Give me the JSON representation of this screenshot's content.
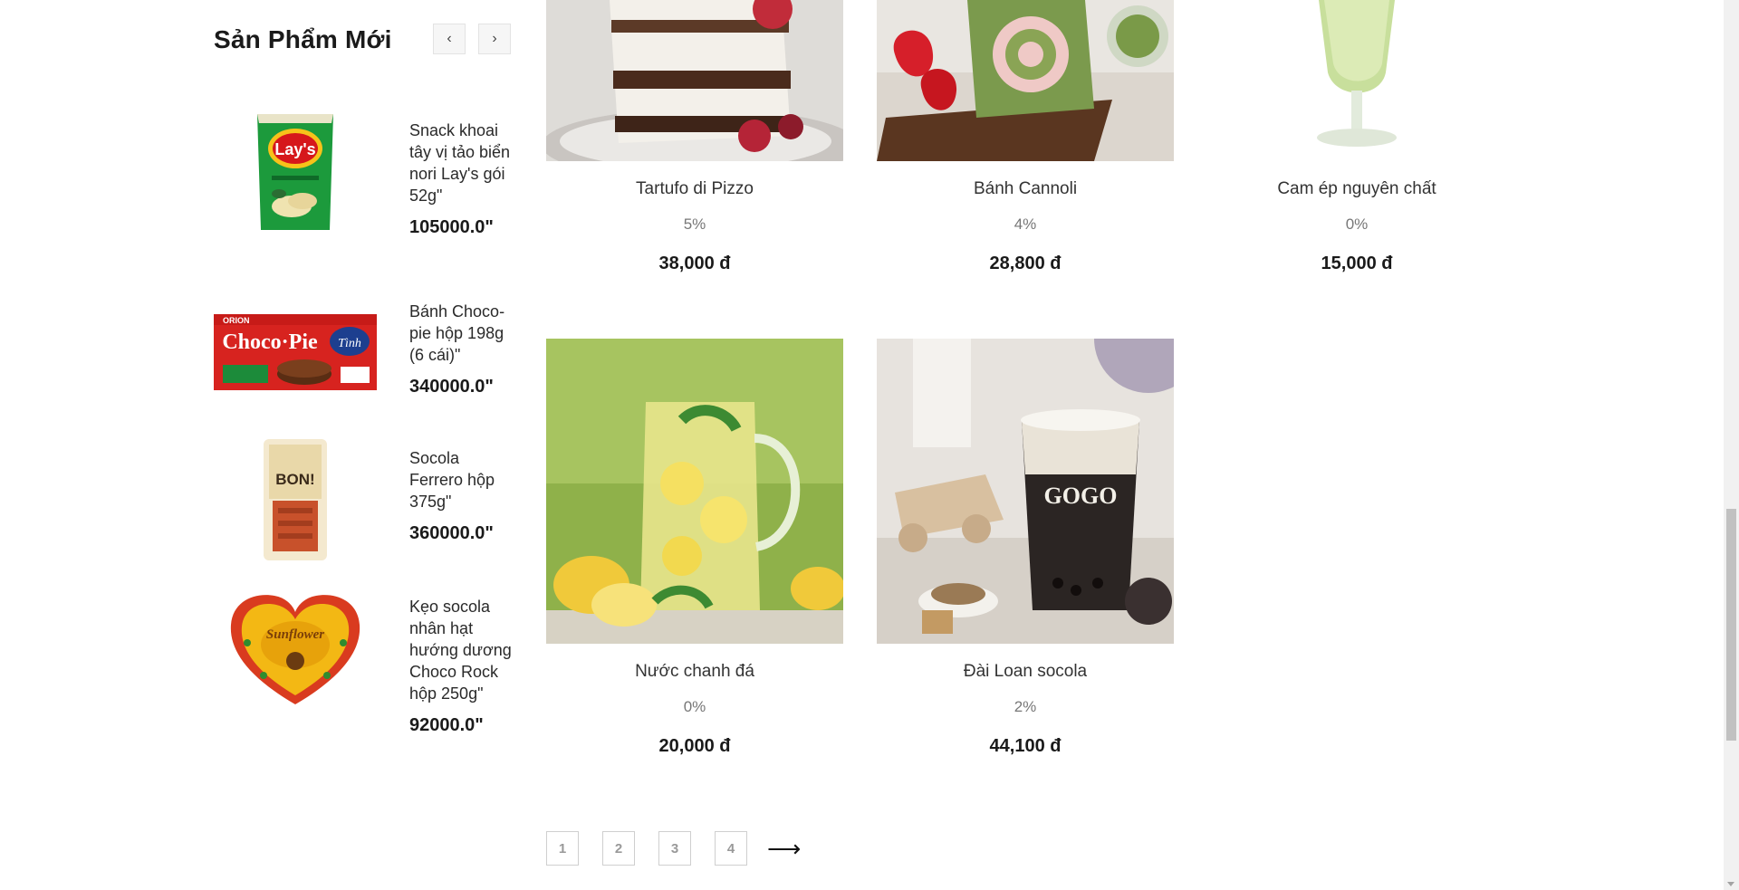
{
  "sidebar": {
    "title": "Sản Phẩm Mới",
    "prev_icon": "‹",
    "next_icon": "›",
    "items": [
      {
        "name": "Snack khoai tây vị tảo biển nori Lay's gói 52g\"",
        "price": "105000.0\""
      },
      {
        "name": "Bánh Choco-pie hộp 198g (6 cái)\"",
        "price": "340000.0\""
      },
      {
        "name": "Socola Ferrero hộp 375g\"",
        "price": "360000.0\""
      },
      {
        "name": "Kẹo socola nhân hạt hướng dương Choco Rock hộp 250g\"",
        "price": "92000.0\""
      }
    ]
  },
  "products": [
    {
      "name": "Tartufo di Pizzo",
      "discount": "5%",
      "price": "38,000 đ"
    },
    {
      "name": "Bánh Cannoli",
      "discount": "4%",
      "price": "28,800 đ"
    },
    {
      "name": "Cam ép nguyên chất",
      "discount": "0%",
      "price": "15,000 đ"
    },
    {
      "name": "Nước chanh đá",
      "discount": "0%",
      "price": "20,000 đ"
    },
    {
      "name": "Đài Loan socola",
      "discount": "2%",
      "price": "44,100 đ"
    }
  ],
  "pagination": {
    "pages": [
      "1",
      "2",
      "3",
      "4"
    ],
    "next_icon": "⟶"
  },
  "images": {
    "lays_text": "Lay's",
    "chocopie_text": "Choco·Pie",
    "orion_text": "ORION",
    "tinh_text": "Tình",
    "bon_text": "BON!",
    "sunflower_text": "Sunflower",
    "gogo_text": "GOGO"
  }
}
